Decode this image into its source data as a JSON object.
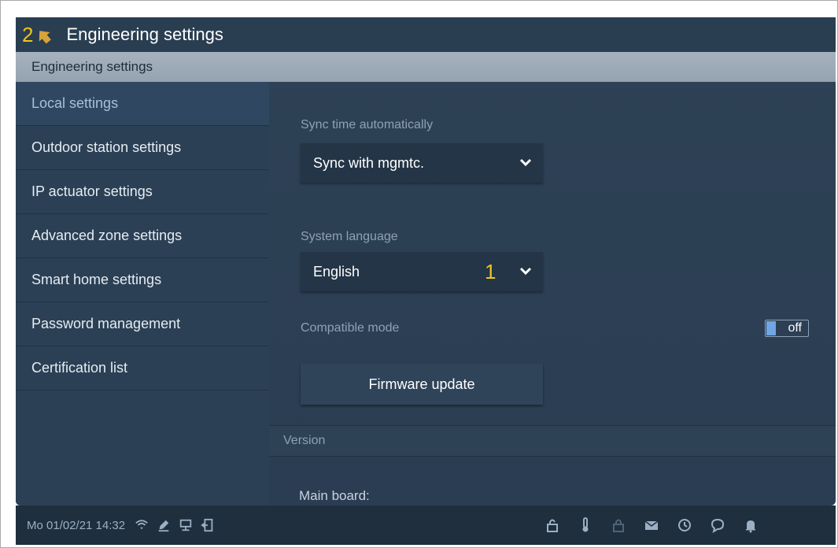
{
  "header": {
    "page_number": "2",
    "title": "Engineering settings"
  },
  "section_header": "Engineering settings",
  "sidebar": {
    "items": [
      {
        "label": "Local settings"
      },
      {
        "label": "Outdoor station settings"
      },
      {
        "label": "IP actuator settings"
      },
      {
        "label": "Advanced zone settings"
      },
      {
        "label": "Smart home settings"
      },
      {
        "label": "Password management"
      },
      {
        "label": "Certification list"
      }
    ],
    "active_index": 0
  },
  "content": {
    "sync_time_label": "Sync time automatically",
    "sync_time_value": "Sync with mgmtc.",
    "system_language_label": "System language",
    "system_language_value": "English",
    "marker": "1",
    "compatible_mode_label": "Compatible mode",
    "compatible_mode_state": "off",
    "firmware_button": "Firmware update",
    "version_section": "Version",
    "main_board_label": "Main board:"
  },
  "statusbar": {
    "datetime": "Mo 01/02/21  14:32",
    "left_icons": [
      "wifi-icon",
      "edit-icon",
      "monitor-icon",
      "exit-door-icon"
    ],
    "right_icons": [
      "lock-icon",
      "thermometer-icon",
      "lock-dim-icon",
      "mail-icon",
      "history-icon",
      "chat-icon",
      "bell-icon"
    ]
  },
  "colors": {
    "accent_yellow": "#f0c419",
    "toggle_blue": "#6fa6e3",
    "background": "#2b4055"
  }
}
